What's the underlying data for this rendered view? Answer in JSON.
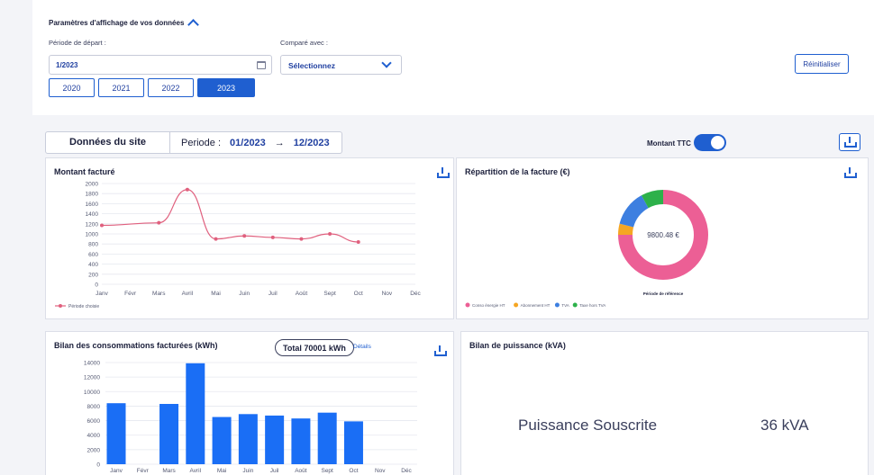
{
  "settings": {
    "title": "Paramètres d'affichage de vos données",
    "start_label": "Période de départ :",
    "start_value": "1/2023",
    "compare_label": "Comparé avec :",
    "compare_value": "Sélectionnez",
    "years": [
      "2020",
      "2021",
      "2022",
      "2023"
    ],
    "active_year": "2023",
    "reset_label": "Réinitialiser"
  },
  "site": {
    "title": "Données du site",
    "period_label": "Periode :",
    "period_start": "01/2023",
    "arrow": "→",
    "period_end": "12/2023",
    "toggle_label": "Montant TTC",
    "toggle_on": true
  },
  "cards": {
    "montant_title": "Montant facturé",
    "repartition_title": "Répartition de la facture (€)",
    "bilan_title": "Bilan des consommations facturées (kWh)",
    "total_label": "Total 70001 kWh",
    "details_label": "Détails",
    "puissance_title": "Bilan de puissance (kVA)",
    "puissance_label": "Puissance Souscrite",
    "puissance_value": "36 kVA"
  },
  "colors": {
    "accent": "#1f5fd0",
    "line": "#e0607e",
    "bar": "#1a6ef5"
  },
  "chart_data": [
    {
      "type": "line",
      "title": "Montant facturé",
      "categories": [
        "Janv",
        "Févr",
        "Mars",
        "Avril",
        "Mai",
        "Juin",
        "Juil",
        "Août",
        "Sept",
        "Oct",
        "Nov",
        "Déc"
      ],
      "series": [
        {
          "name": "Période choisie",
          "values": [
            1170,
            null,
            1220,
            1880,
            900,
            960,
            930,
            900,
            1000,
            840,
            null,
            null
          ]
        }
      ],
      "yticks": [
        0,
        200,
        400,
        600,
        800,
        1000,
        1200,
        1400,
        1600,
        1800,
        2000
      ],
      "ylim": [
        0,
        2000
      ],
      "grid": true,
      "legend": "bottom-left"
    },
    {
      "type": "pie",
      "title": "Répartition de la facture (€)",
      "center_label": "9800.48 €",
      "sublabel": "Période de référence",
      "slices": [
        {
          "name": "Conso énergie HT",
          "value": 75,
          "color": "#ec5f95"
        },
        {
          "name": "Abonnement HT",
          "value": 4,
          "color": "#f5a623"
        },
        {
          "name": "TVA",
          "value": 13,
          "color": "#3d7fe0"
        },
        {
          "name": "Taxe hors TVA",
          "value": 8,
          "color": "#2db14a"
        }
      ],
      "legend": "bottom"
    },
    {
      "type": "bar",
      "title": "Bilan des consommations facturées (kWh)",
      "categories": [
        "Janv",
        "Févr",
        "Mars",
        "Avril",
        "Mai",
        "Juin",
        "Juil",
        "Août",
        "Sept",
        "Oct",
        "Nov",
        "Déc"
      ],
      "values": [
        8400,
        0,
        8300,
        13900,
        6500,
        6900,
        6700,
        6300,
        7100,
        5900,
        0,
        0
      ],
      "yticks": [
        0,
        2000,
        4000,
        6000,
        8000,
        10000,
        12000,
        14000
      ],
      "ylim": [
        0,
        14000
      ],
      "grid": true
    }
  ]
}
